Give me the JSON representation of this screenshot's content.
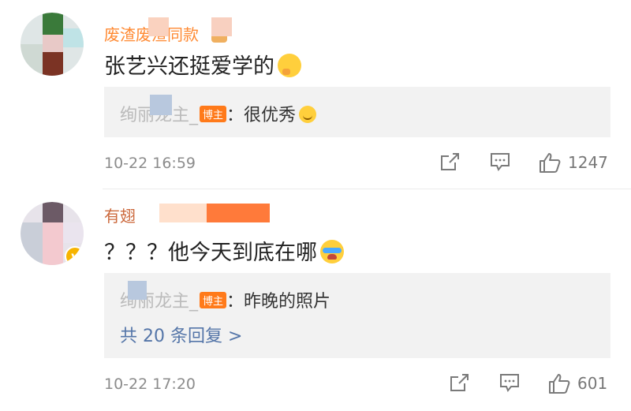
{
  "comments": [
    {
      "username": "废渣废渣同款",
      "text": "张艺兴还挺爱学的",
      "emoji": "cheeky-face",
      "reply": {
        "author": "绚丽龙主_",
        "badge": "博主",
        "separator": "：",
        "text": "很优秀",
        "emoji": "smile-face"
      },
      "time": "10-22 16:59",
      "likes": "1247"
    },
    {
      "username": "有翅",
      "text": "？？？他今天到底在哪",
      "emoji": "crying-face",
      "reply": {
        "author": "绚丽龙主_",
        "badge": "博主",
        "separator": "：",
        "text": "昨晚的照片"
      },
      "more_replies": "共 20 条回复 >",
      "time": "10-22 17:20",
      "likes": "601"
    }
  ],
  "colors": {
    "badge": "#ff7a1a",
    "link": "#5475a8",
    "verified": "#f7b400",
    "username_highlight": "#ff8a33",
    "mosaic_orange": "#ff7a3a"
  }
}
